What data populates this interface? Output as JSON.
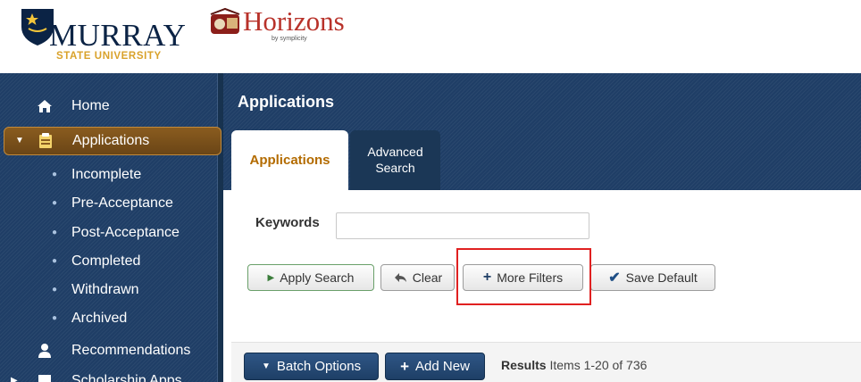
{
  "header": {
    "murray": {
      "name": "MURRAY",
      "subtitle": "STATE UNIVERSITY"
    },
    "horizons": {
      "name": "Horizons",
      "by": "by symplicity"
    }
  },
  "sidebar": {
    "items": [
      {
        "label": "Home",
        "icon": "home-icon"
      },
      {
        "label": "Applications",
        "icon": "applications-icon",
        "active": true
      },
      {
        "label": "Recommendations",
        "icon": "user-icon"
      },
      {
        "label": "Scholarship Apps",
        "icon": "scholarship-icon"
      }
    ],
    "subitems": [
      "Incomplete",
      "Pre-Acceptance",
      "Post-Acceptance",
      "Completed",
      "Withdrawn",
      "Archived"
    ]
  },
  "main": {
    "title": "Applications",
    "tabs": [
      {
        "label": "Applications",
        "active": true
      },
      {
        "label": "Advanced\nSearch",
        "active": false
      }
    ],
    "search": {
      "keywords_label": "Keywords",
      "keywords_value": "",
      "buttons": {
        "apply": "Apply Search",
        "clear": "Clear",
        "more": "More Filters",
        "save": "Save Default"
      }
    },
    "bottom": {
      "batch": "Batch Options",
      "add": "Add New",
      "results_label": "Results",
      "results_count": "Items 1-20 of 736"
    }
  },
  "colors": {
    "navy": "#1f3e66",
    "active_nav": "#7a5119",
    "tab_active_text": "#b36b00",
    "highlight": "#e02020"
  }
}
